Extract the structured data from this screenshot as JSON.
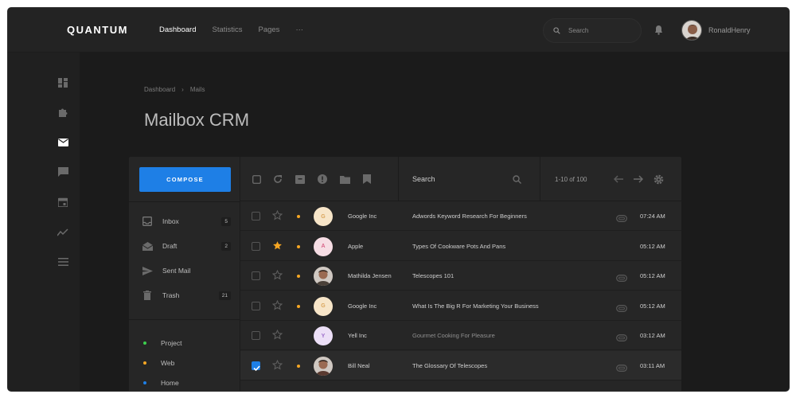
{
  "app": {
    "brand": "QUANTUM"
  },
  "nav": {
    "items": [
      "Dashboard",
      "Statistics",
      "Pages",
      "···"
    ]
  },
  "top_search": {
    "placeholder": "Search"
  },
  "user": {
    "name": "RonaldHenry"
  },
  "breadcrumb": {
    "items": [
      "Dashboard",
      "Mails"
    ]
  },
  "page_title": "Mailbox CRM",
  "compose_label": "COMPOSE",
  "folders": [
    {
      "label": "Inbox",
      "count": "5"
    },
    {
      "label": "Draft",
      "count": "2"
    },
    {
      "label": "Sent Mail",
      "count": ""
    },
    {
      "label": "Trash",
      "count": "21"
    }
  ],
  "labels": [
    {
      "label": "Project",
      "color": "#3ccf4e"
    },
    {
      "label": "Web",
      "color": "#f5a623"
    },
    {
      "label": "Home",
      "color": "#1e7fe6"
    }
  ],
  "toolbar": {
    "search_label": "Search",
    "pager": "1-10 of 100"
  },
  "colors": {
    "accent": "#1e7fe6",
    "star": "#f5a623",
    "unread_dot": "#f5a623"
  },
  "emails": [
    {
      "sender": "Google Inc",
      "initial": "G",
      "avatar_bg": "#f7e5c8",
      "avatar_fg": "#d9a55a",
      "subject": "Adwords Keyword Research For Beginners",
      "time": "07:24 AM",
      "starred": false,
      "unread": true,
      "attachment": true,
      "checked": false,
      "photo": false
    },
    {
      "sender": "Apple",
      "initial": "A",
      "avatar_bg": "#f6dde4",
      "avatar_fg": "#d9668a",
      "subject": "Types Of Cookware Pots And Pans",
      "time": "05:12 AM",
      "starred": true,
      "unread": true,
      "attachment": false,
      "checked": false,
      "photo": false
    },
    {
      "sender": "Mathilda Jensen",
      "initial": "",
      "avatar_bg": "#4a4038",
      "avatar_fg": "#ffffff",
      "subject": "Telescopes 101",
      "time": "05:12 AM",
      "starred": false,
      "unread": true,
      "attachment": true,
      "checked": false,
      "photo": true
    },
    {
      "sender": "Google Inc",
      "initial": "G",
      "avatar_bg": "#f7e5c8",
      "avatar_fg": "#d9a55a",
      "subject": "What Is The Big R For Marketing Your Business",
      "time": "05:12 AM",
      "starred": false,
      "unread": true,
      "attachment": true,
      "checked": false,
      "photo": false
    },
    {
      "sender": "Yell Inc",
      "initial": "Y",
      "avatar_bg": "#ecdff7",
      "avatar_fg": "#9b6bc9",
      "subject": "Gourmet Cooking For Pleasure",
      "time": "03:12 AM",
      "starred": false,
      "unread": false,
      "attachment": true,
      "checked": false,
      "photo": false
    },
    {
      "sender": "Bill Neal",
      "initial": "",
      "avatar_bg": "#5a3a30",
      "avatar_fg": "#ffffff",
      "subject": "The Glossary Of Telescopes",
      "time": "03:11 AM",
      "starred": false,
      "unread": true,
      "attachment": true,
      "checked": true,
      "photo": true
    }
  ]
}
